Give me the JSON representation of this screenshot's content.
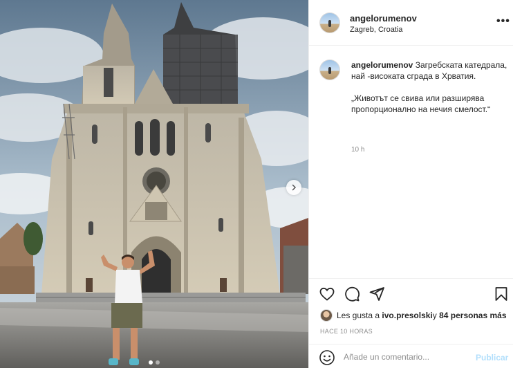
{
  "post": {
    "username": "angelorumenov",
    "location": "Zagreb, Croatia",
    "more_icon": "more-horizontal-icon"
  },
  "caption": {
    "username": "angelorumenov",
    "text_line1": "Загребската катедрала, най -високата сграда в Хрватия.",
    "text_line2": "„Животът се свива или разширява пропорционално на нечия смелост.“",
    "time": "10 h"
  },
  "actions": {
    "like_icon": "heart-icon",
    "comment_icon": "comment-icon",
    "share_icon": "paper-plane-icon",
    "save_icon": "bookmark-icon"
  },
  "likes": {
    "prefix": "Les gusta a ",
    "user": "ivo.presolski",
    "middle": " y ",
    "count": "84 personas más"
  },
  "timeago": "HACE 10 HORAS",
  "comment": {
    "placeholder": "Añade un comentario...",
    "publish_label": "Publicar",
    "emoji_icon": "smiley-icon"
  },
  "carousel": {
    "next_icon": "chevron-right-icon",
    "total": 2,
    "current": 1
  },
  "colors": {
    "publish": "#b2dffc",
    "muted": "#8e8e8e",
    "text": "#262626"
  }
}
